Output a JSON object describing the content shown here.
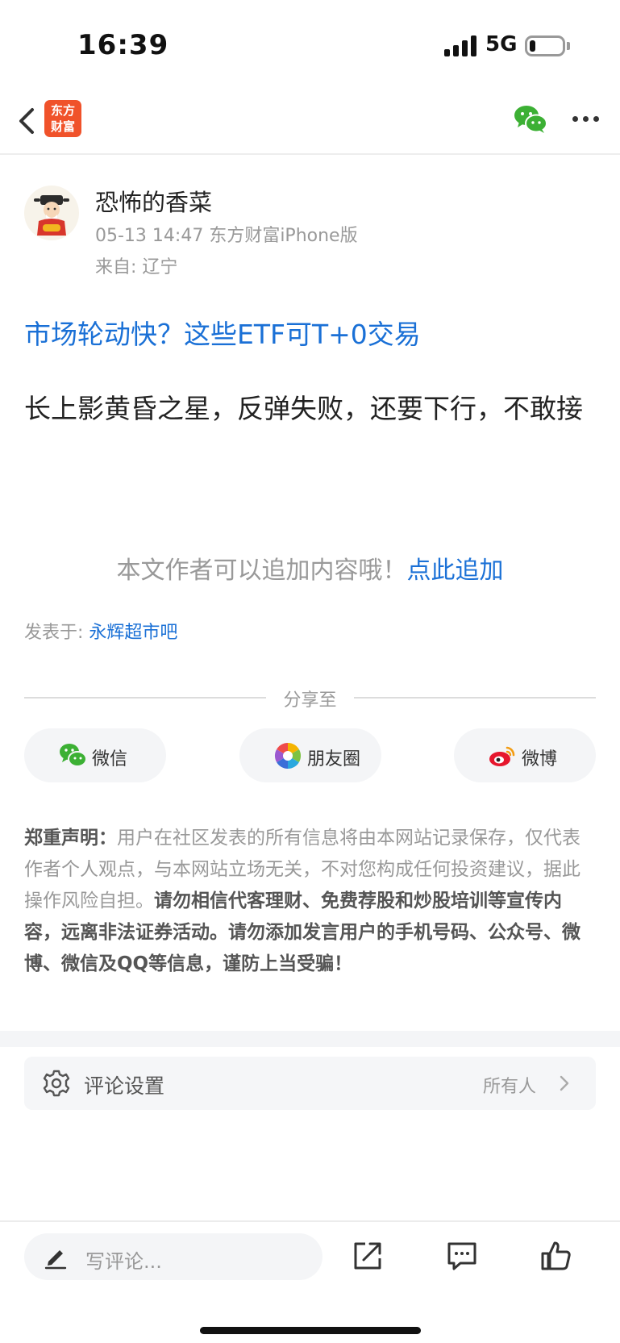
{
  "status_bar": {
    "time": "16:39",
    "network": "5G"
  },
  "nav": {
    "logo_line1": "东方",
    "logo_line2": "财富"
  },
  "author": {
    "name": "恐怖的香菜",
    "meta": "05-13 14:47 东方财富iPhone版",
    "location": "来自: 辽宁"
  },
  "post": {
    "headline_link": "市场轮动快？这些ETF可T+0交易",
    "body": "长上影黄昏之星，反弹失败，还要下行，不敢接"
  },
  "append": {
    "prompt": "本文作者可以追加内容哦！",
    "link": "点此追加"
  },
  "posted_in": {
    "label": "发表于: ",
    "bar_name": "永辉超市吧"
  },
  "share": {
    "title": "分享至",
    "wechat": "微信",
    "moments": "朋友圈",
    "weibo": "微博"
  },
  "disclaimer": {
    "heading": "郑重声明：",
    "normal": "用户在社区发表的所有信息将由本网站记录保存，仅代表作者个人观点，与本网站立场无关，不对您构成任何投资建议，据此操作风险自担。",
    "bold": "请勿相信代客理财、免费荐股和炒股培训等宣传内容，远离非法证券活动。请勿添加发言用户的手机号码、公众号、微博、微信及QQ等信息，谨防上当受骗！"
  },
  "comment_settings": {
    "label": "评论设置",
    "value": "所有人"
  },
  "bottom_bar": {
    "comment_placeholder": "写评论..."
  },
  "colors": {
    "link_blue": "#1a70d6",
    "brand_orange": "#f0522a",
    "wechat_green": "#3cb034",
    "weibo_red": "#e6162d"
  }
}
